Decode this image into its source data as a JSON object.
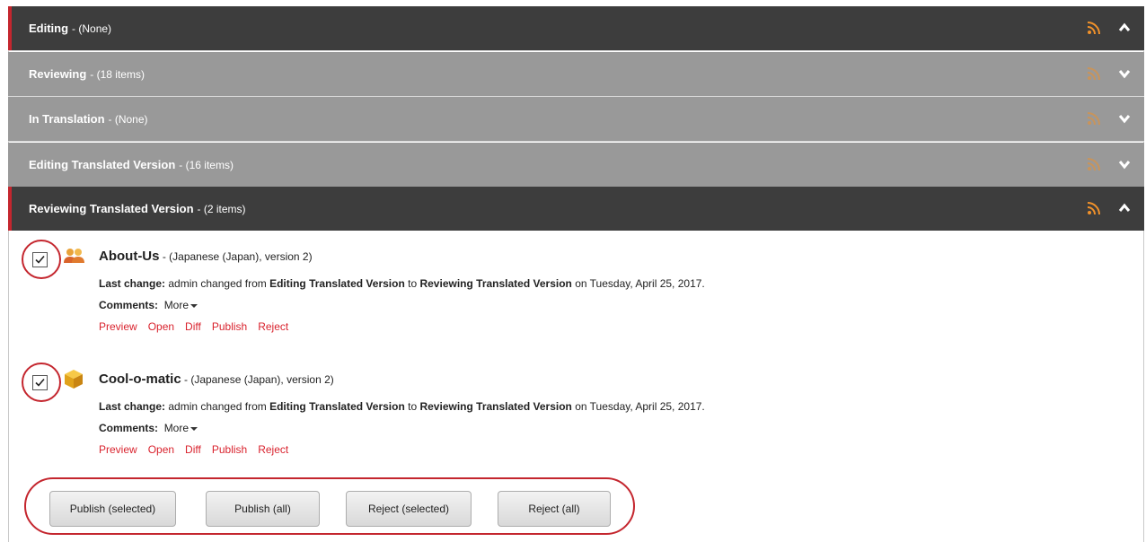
{
  "sections": [
    {
      "title": "Editing",
      "count": " - (None)",
      "expanded": true
    },
    {
      "title": "Reviewing",
      "count": " - (18 items)",
      "expanded": false
    },
    {
      "title": "In Translation",
      "count": " - (None)",
      "expanded": false
    },
    {
      "title": "Editing Translated Version",
      "count": " - (16 items)",
      "expanded": false
    },
    {
      "title": "Reviewing Translated Version",
      "count": " - (2 items)",
      "expanded": true
    }
  ],
  "items": [
    {
      "name": "About-Us",
      "meta": " - (Japanese (Japan), version 2)",
      "icon": "users-icon",
      "checked": true,
      "last_change_label": "Last change:",
      "last_change_user": " admin changed from ",
      "from_state": "Editing Translated Version",
      "to_word": " to ",
      "to_state": "Reviewing Translated Version",
      "date": " on Tuesday, April 25, 2017.",
      "comments_label": "Comments:",
      "more_label": "More",
      "actions": [
        "Preview",
        "Open",
        "Diff",
        "Publish",
        "Reject"
      ]
    },
    {
      "name": "Cool-o-matic",
      "meta": " - (Japanese (Japan), version 2)",
      "icon": "product-box-icon",
      "checked": true,
      "last_change_label": "Last change:",
      "last_change_user": " admin changed from ",
      "from_state": "Editing Translated Version",
      "to_word": " to ",
      "to_state": "Reviewing Translated Version",
      "date": " on Tuesday, April 25, 2017.",
      "comments_label": "Comments:",
      "more_label": "More",
      "actions": [
        "Preview",
        "Open",
        "Diff",
        "Publish",
        "Reject"
      ]
    }
  ],
  "buttons": {
    "publish_selected": "Publish (selected)",
    "publish_all": "Publish (all)",
    "reject_selected": "Reject (selected)",
    "reject_all": "Reject (all)"
  },
  "colors": {
    "accent": "#c4262e",
    "link": "#d9232e",
    "header_dark": "#3d3d3d",
    "header_grey": "#999999",
    "rss": "#f0912a"
  }
}
